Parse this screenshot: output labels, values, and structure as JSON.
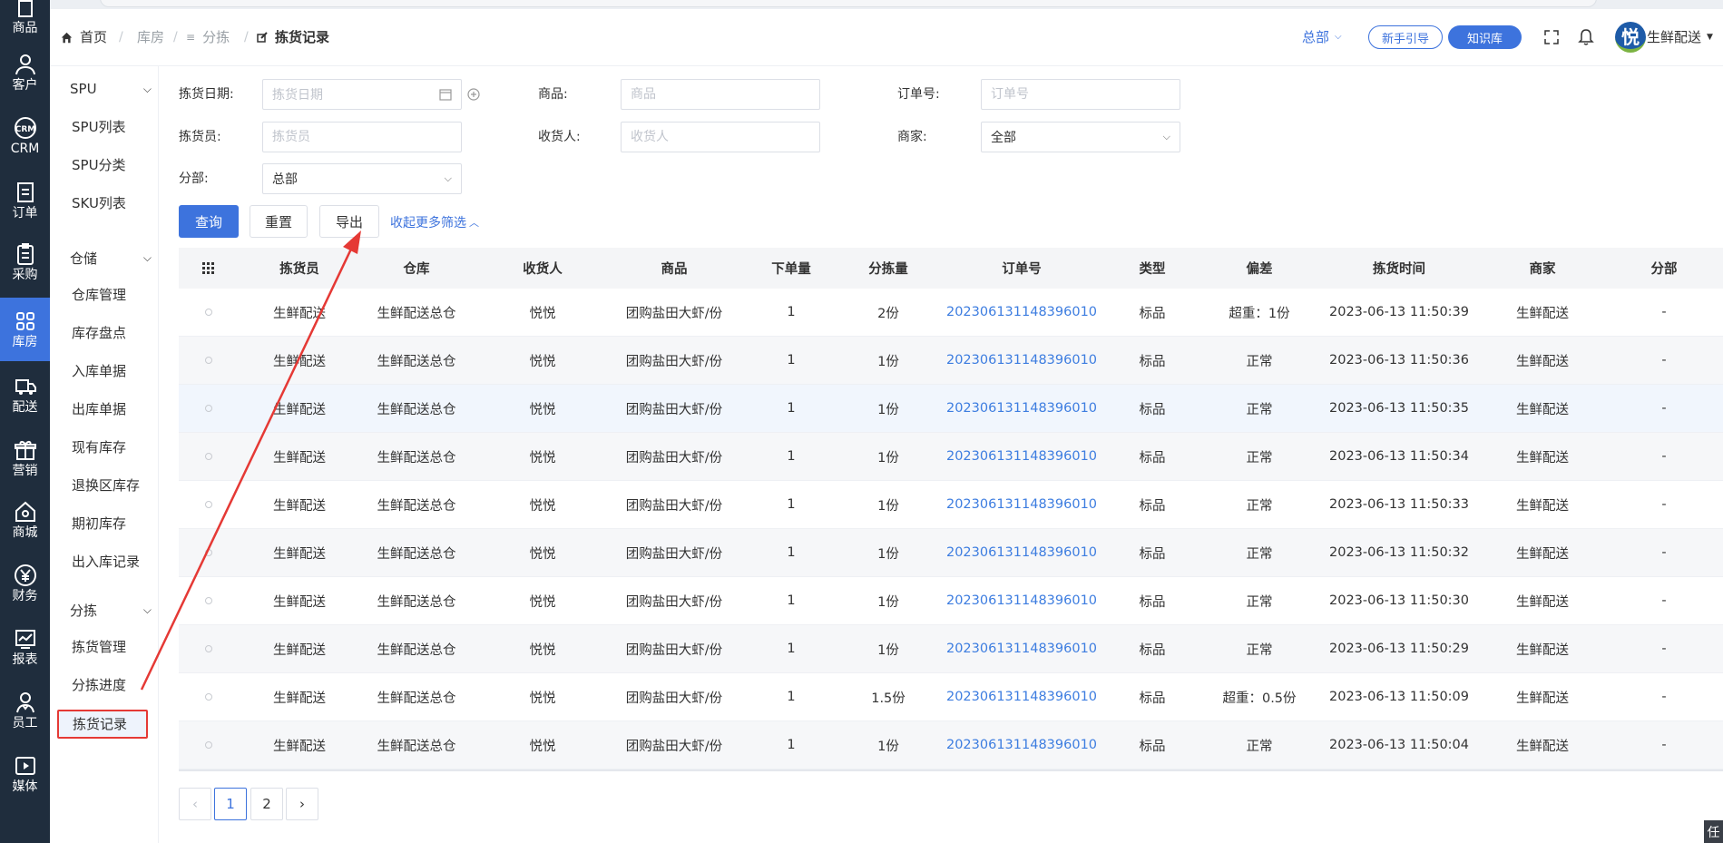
{
  "rail": [
    {
      "label": "商品",
      "icon": "bag-icon"
    },
    {
      "label": "客户",
      "icon": "person-icon"
    },
    {
      "label": "CRM",
      "icon": "crm-icon"
    },
    {
      "label": "订单",
      "icon": "document-icon"
    },
    {
      "label": "采购",
      "icon": "clipboard-icon"
    },
    {
      "label": "库房",
      "icon": "grid-icon"
    },
    {
      "label": "配送",
      "icon": "truck-icon"
    },
    {
      "label": "营销",
      "icon": "gift-icon"
    },
    {
      "label": "商城",
      "icon": "home-icon"
    },
    {
      "label": "财务",
      "icon": "yen-icon"
    },
    {
      "label": "报表",
      "icon": "chart-icon"
    },
    {
      "label": "员工",
      "icon": "staff-icon"
    },
    {
      "label": "媒体",
      "icon": "play-icon"
    }
  ],
  "breadcrumb": {
    "home": "首页",
    "level1": "库房",
    "level2": "分拣",
    "current": "拣货记录"
  },
  "header": {
    "branch": "总部",
    "guide_button": "新手引导",
    "kb_button": "知识库",
    "avatar_char": "悦",
    "user_name": "生鲜配送"
  },
  "subnav": {
    "groups": [
      {
        "title": "SPU",
        "items": [
          "SPU列表",
          "SPU分类",
          "SKU列表"
        ]
      },
      {
        "title": "仓储",
        "items": [
          "仓库管理",
          "库存盘点",
          "入库单据",
          "出库单据",
          "现有库存",
          "退换区库存",
          "期初库存",
          "出入库记录"
        ]
      },
      {
        "title": "分拣",
        "items": [
          "拣货管理",
          "分拣进度",
          "拣货记录"
        ]
      }
    ]
  },
  "filters": {
    "pick_date": {
      "label": "拣货日期:",
      "placeholder": "拣货日期"
    },
    "product": {
      "label": "商品:",
      "placeholder": "商品"
    },
    "order_no": {
      "label": "订单号:",
      "placeholder": "订单号"
    },
    "picker": {
      "label": "拣货员:",
      "placeholder": "拣货员"
    },
    "receiver": {
      "label": "收货人:",
      "placeholder": "收货人"
    },
    "merchant": {
      "label": "商家:",
      "value": "全部"
    },
    "branch": {
      "label": "分部:",
      "value": "总部"
    },
    "query_button": "查询",
    "reset_button": "重置",
    "export_button": "导出",
    "collapse_link": "收起更多筛选"
  },
  "table": {
    "columns": [
      "拣货员",
      "仓库",
      "收货人",
      "商品",
      "下单量",
      "分拣量",
      "订单号",
      "类型",
      "偏差",
      "拣货时间",
      "商家",
      "分部"
    ],
    "rows": [
      [
        "生鲜配送",
        "生鲜配送总仓",
        "悦悦",
        "团购盐田大虾/份",
        "1",
        "2份",
        "202306131148396010",
        "标品",
        "超重：1份",
        "2023-06-13 11:50:39",
        "生鲜配送",
        "-"
      ],
      [
        "生鲜配送",
        "生鲜配送总仓",
        "悦悦",
        "团购盐田大虾/份",
        "1",
        "1份",
        "202306131148396010",
        "标品",
        "正常",
        "2023-06-13 11:50:36",
        "生鲜配送",
        "-"
      ],
      [
        "生鲜配送",
        "生鲜配送总仓",
        "悦悦",
        "团购盐田大虾/份",
        "1",
        "1份",
        "202306131148396010",
        "标品",
        "正常",
        "2023-06-13 11:50:35",
        "生鲜配送",
        "-"
      ],
      [
        "生鲜配送",
        "生鲜配送总仓",
        "悦悦",
        "团购盐田大虾/份",
        "1",
        "1份",
        "202306131148396010",
        "标品",
        "正常",
        "2023-06-13 11:50:34",
        "生鲜配送",
        "-"
      ],
      [
        "生鲜配送",
        "生鲜配送总仓",
        "悦悦",
        "团购盐田大虾/份",
        "1",
        "1份",
        "202306131148396010",
        "标品",
        "正常",
        "2023-06-13 11:50:33",
        "生鲜配送",
        "-"
      ],
      [
        "生鲜配送",
        "生鲜配送总仓",
        "悦悦",
        "团购盐田大虾/份",
        "1",
        "1份",
        "202306131148396010",
        "标品",
        "正常",
        "2023-06-13 11:50:32",
        "生鲜配送",
        "-"
      ],
      [
        "生鲜配送",
        "生鲜配送总仓",
        "悦悦",
        "团购盐田大虾/份",
        "1",
        "1份",
        "202306131148396010",
        "标品",
        "正常",
        "2023-06-13 11:50:30",
        "生鲜配送",
        "-"
      ],
      [
        "生鲜配送",
        "生鲜配送总仓",
        "悦悦",
        "团购盐田大虾/份",
        "1",
        "1份",
        "202306131148396010",
        "标品",
        "正常",
        "2023-06-13 11:50:29",
        "生鲜配送",
        "-"
      ],
      [
        "生鲜配送",
        "生鲜配送总仓",
        "悦悦",
        "团购盐田大虾/份",
        "1",
        "1.5份",
        "202306131148396010",
        "标品",
        "超重：0.5份",
        "2023-06-13 11:50:09",
        "生鲜配送",
        "-"
      ],
      [
        "生鲜配送",
        "生鲜配送总仓",
        "悦悦",
        "团购盐田大虾/份",
        "1",
        "1份",
        "202306131148396010",
        "标品",
        "正常",
        "2023-06-13 11:50:04",
        "生鲜配送",
        "-"
      ]
    ]
  },
  "pagination": {
    "pages": [
      "1",
      "2"
    ],
    "current": "1"
  },
  "corner_badge": "任",
  "colors": {
    "primary": "#3d73dd",
    "rail_bg": "#1f2d3d",
    "link": "#3d7de0",
    "annotation": "#e53935"
  }
}
